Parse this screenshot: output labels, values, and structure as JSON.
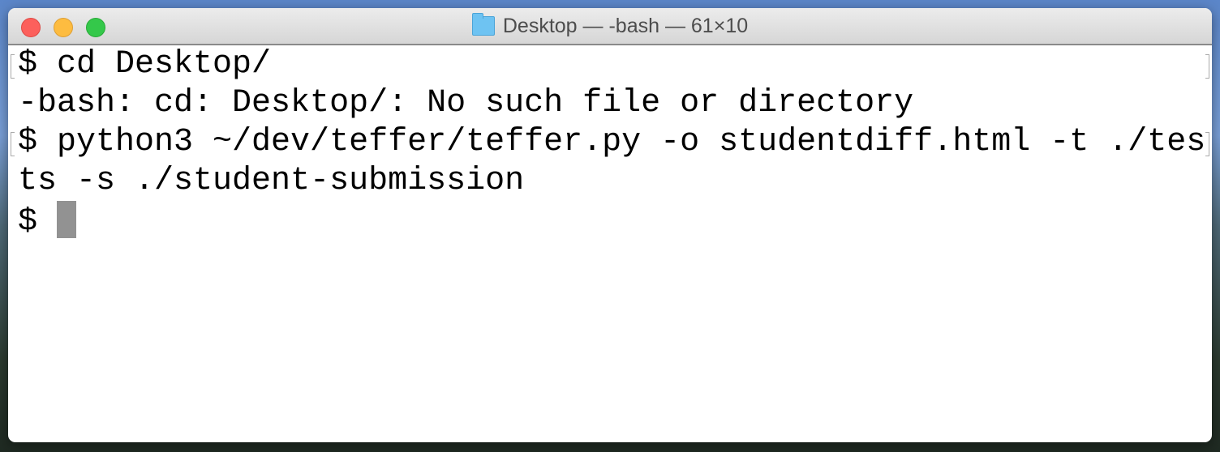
{
  "window": {
    "title": "Desktop — -bash — 61×10",
    "title_icon": "folder-icon"
  },
  "terminal": {
    "lines": [
      "$ cd Desktop/",
      "-bash: cd: Desktop/: No such file or directory",
      "$ python3 ~/dev/teffer/teffer.py -o studentdiff.html -t ./tes",
      "ts -s ./student-submission"
    ],
    "prompt": "$ "
  }
}
